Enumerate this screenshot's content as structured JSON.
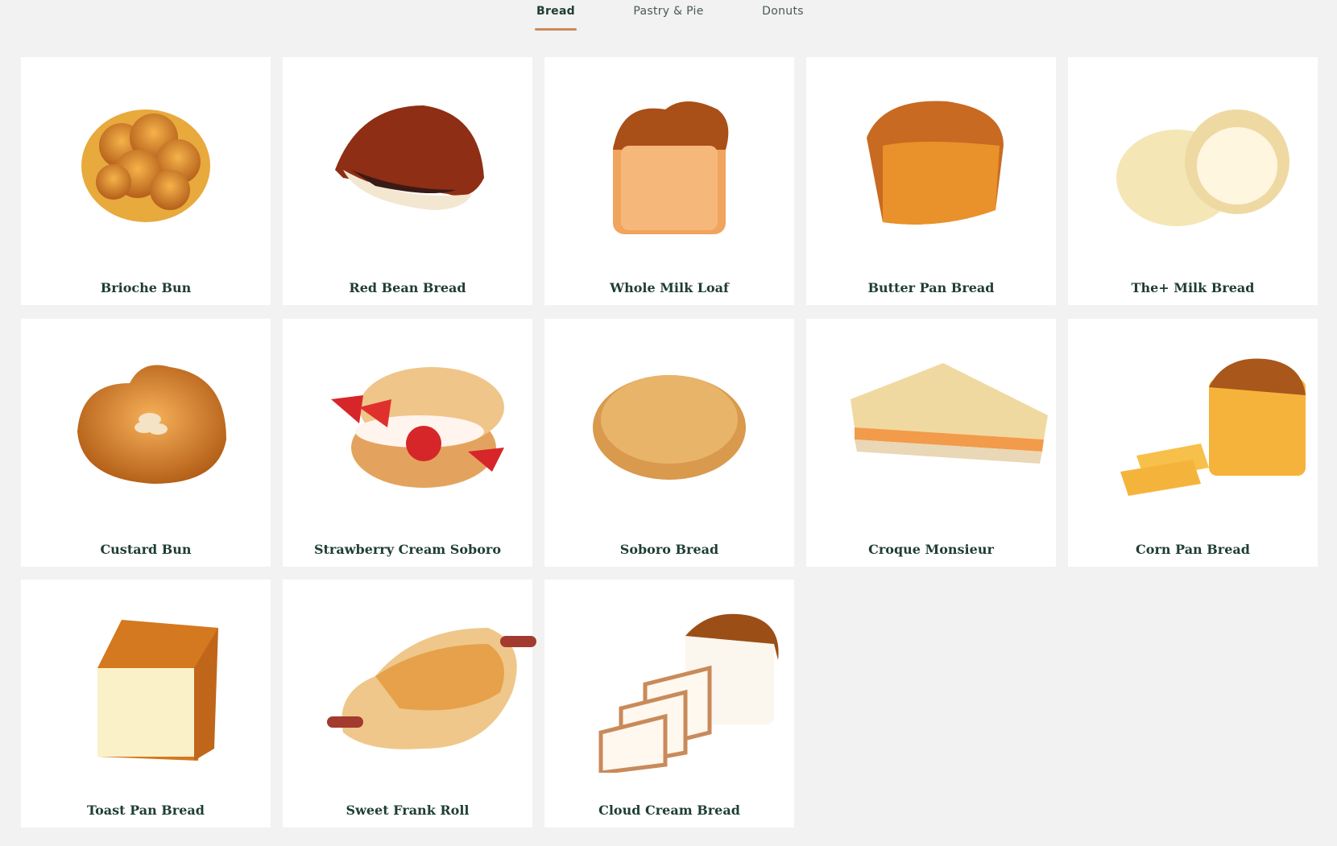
{
  "tabs": [
    {
      "label": "Bread",
      "active": true
    },
    {
      "label": "Pastry & Pie",
      "active": false
    },
    {
      "label": "Donuts",
      "active": false
    }
  ],
  "colors": {
    "accent": "#c98a5a",
    "title": "#1f3d35",
    "background": "#f2f2f2",
    "card": "#ffffff"
  },
  "products": [
    {
      "name": "Brioche Bun",
      "icon": "brioche-bun-image"
    },
    {
      "name": "Red Bean Bread",
      "icon": "red-bean-bread-image"
    },
    {
      "name": "Whole Milk Loaf",
      "icon": "whole-milk-loaf-image"
    },
    {
      "name": "Butter Pan Bread",
      "icon": "butter-pan-bread-image"
    },
    {
      "name": "The+ Milk Bread",
      "icon": "milk-bread-image"
    },
    {
      "name": "Custard Bun",
      "icon": "custard-bun-image"
    },
    {
      "name": "Strawberry Cream Soboro",
      "icon": "strawberry-cream-soboro-image"
    },
    {
      "name": "Soboro Bread",
      "icon": "soboro-bread-image"
    },
    {
      "name": "Croque Monsieur",
      "icon": "croque-monsieur-image"
    },
    {
      "name": "Corn Pan Bread",
      "icon": "corn-pan-bread-image"
    },
    {
      "name": "Toast Pan Bread",
      "icon": "toast-pan-bread-image"
    },
    {
      "name": "Sweet Frank Roll",
      "icon": "sweet-frank-roll-image"
    },
    {
      "name": "Cloud Cream Bread",
      "icon": "cloud-cream-bread-image"
    }
  ]
}
